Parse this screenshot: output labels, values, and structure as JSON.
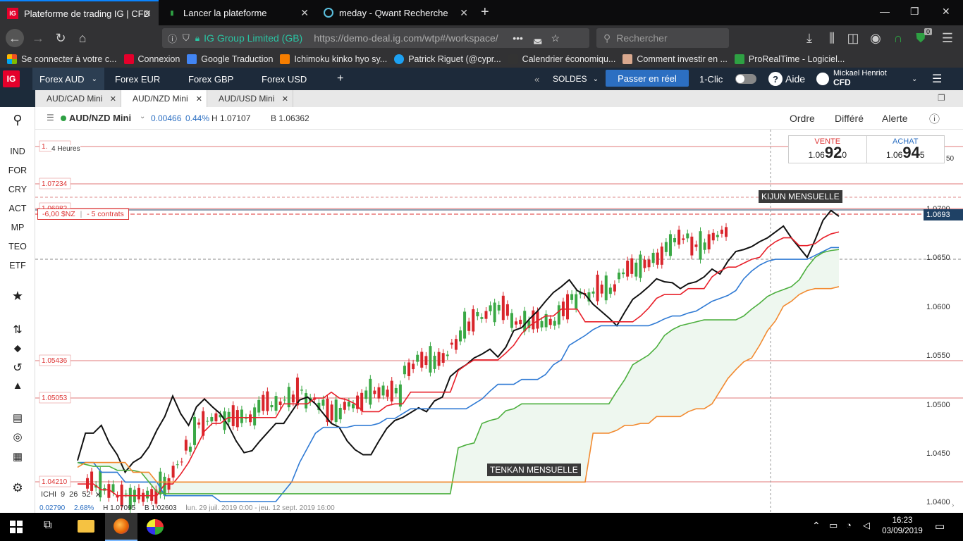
{
  "browser": {
    "tabs": [
      {
        "title": "Plateforme de trading IG | CFD",
        "active": true
      },
      {
        "title": "Lancer la plateforme",
        "active": false
      },
      {
        "title": "meday - Qwant Recherche",
        "active": false
      }
    ],
    "site_identity": "IG Group Limited (GB)",
    "url": "https://demo-deal.ig.com/wtp#/workspace/",
    "search_placeholder": "Rechercher",
    "bookmarks": [
      "Se connecter à votre c...",
      "Connexion",
      "Google Traduction",
      "Ichimoku kinko hyo sy...",
      "Patrick Riguet (@cypr...",
      "Calendrier économiqu...",
      "Comment investir en ...",
      "ProRealTime - Logiciel..."
    ],
    "ext_badge": "0"
  },
  "ig": {
    "logo": "IG",
    "workspaces": [
      "Forex AUD",
      "Forex EUR",
      "Forex GBP",
      "Forex USD"
    ],
    "add_tab": "+",
    "soldes": "SOLDES",
    "go_live": "Passer en réel",
    "one_click": "1-Clic",
    "help": "Aide",
    "user_name": "Mickael Henriot",
    "user_account": "CFD",
    "market_tabs": [
      "AUD/CAD Mini",
      "AUD/NZD Mini",
      "AUD/USD Mini"
    ],
    "left_nav": [
      "IND",
      "FOR",
      "CRY",
      "ACT",
      "MP",
      "TEO",
      "ETF"
    ]
  },
  "panel": {
    "market_name": "AUD/NZD Mini",
    "change": "0.00466",
    "change_pct": "0.44%",
    "high": "H 1.07107",
    "low": "B 1.06362",
    "actions": [
      "Ordre",
      "Différé",
      "Alerte"
    ]
  },
  "ticket": {
    "sell_label": "VENTE",
    "sell_prefix": "1.06",
    "sell_big": "92",
    "sell_small": "0",
    "buy_label": "ACHAT",
    "buy_prefix": "1.06",
    "buy_big": "94",
    "buy_small": "5"
  },
  "chart": {
    "timeframe": "4 Heures",
    "position_pnl": "-6,00 $NZ",
    "position_size": "- 5 contrats",
    "level_labels": [
      "1.07234",
      "1.06982",
      "1.05436",
      "1.05053",
      "1.04210",
      "1."
    ],
    "annotation_kijun": "KIJUN MENSUELLE",
    "annotation_tenkan": "TENKAN MENSUELLE",
    "price_axis": [
      "1.0700",
      "1.0650",
      "1.0600",
      "1.0550",
      "1.0500",
      "1.0450",
      "1.0400"
    ],
    "axis_top_partial": "50",
    "current_price": "1.0693",
    "indicator_name": "ICHI",
    "indicator_params": [
      "9",
      "26",
      "52"
    ],
    "footer_change": "0.02790",
    "footer_pct": "2.68%",
    "footer_high": "H 1.07095",
    "footer_low": "B 1.02603",
    "footer_range": "lun. 29 juil. 2019 0:00 - jeu. 12 sept. 2019 16:00"
  },
  "chart_data": {
    "type": "line",
    "ylim": [
      1.0395,
      1.0755
    ],
    "series": [
      {
        "name": "",
        "color": "#111111",
        "values": [
          1.0442,
          1.047,
          1.047,
          1.0478,
          1.046,
          1.0448,
          1.043,
          1.044,
          1.0445,
          1.0456,
          1.0473,
          1.0487,
          1.0508,
          1.049,
          1.0478,
          1.0497,
          1.0505,
          1.0497,
          1.049,
          1.0478,
          1.0462,
          1.045,
          1.0452,
          1.0462,
          1.0471,
          1.048,
          1.048,
          1.0492,
          1.0504,
          1.0507,
          1.05,
          1.049,
          1.048,
          1.0476,
          1.0462,
          1.0453,
          1.0448,
          1.0448,
          1.0462,
          1.0475,
          1.0483,
          1.0486,
          1.0491,
          1.0496,
          1.0492,
          1.0503,
          1.0507,
          1.0528,
          1.0535,
          1.054,
          1.0547,
          1.0551,
          1.0556,
          1.0548,
          1.0558,
          1.0575,
          1.0578,
          1.0587,
          1.0595,
          1.0605,
          1.0614,
          1.062,
          1.0627,
          1.0616,
          1.0612,
          1.0602,
          1.0595,
          1.0588,
          1.058,
          1.0594,
          1.0607,
          1.0613,
          1.062,
          1.0628,
          1.0625,
          1.0624,
          1.0618,
          1.0623,
          1.0625,
          1.063,
          1.0638,
          1.0633,
          1.0646,
          1.0656,
          1.0658,
          1.0661,
          1.0666,
          1.067,
          1.0676,
          1.0682,
          1.067,
          1.066,
          1.065,
          1.0668,
          1.0688,
          1.0698,
          1.0692
        ]
      },
      {
        "name": "",
        "color": "#e8202a",
        "values": [
          1.0418,
          1.0418,
          1.0418,
          1.0412,
          1.0412,
          1.0406,
          1.0406,
          1.0406,
          1.0406,
          1.0406,
          1.0406,
          1.0418,
          1.0418,
          1.0428,
          1.044,
          1.0456,
          1.0472,
          1.048,
          1.048,
          1.0486,
          1.0486,
          1.0486,
          1.0486,
          1.0486,
          1.0486,
          1.0486,
          1.05,
          1.05,
          1.05,
          1.05,
          1.0506,
          1.0506,
          1.0512,
          1.0506,
          1.0504,
          1.05,
          1.0492,
          1.0492,
          1.0492,
          1.0498,
          1.05,
          1.05,
          1.0512,
          1.0512,
          1.0512,
          1.0512,
          1.0512,
          1.0512,
          1.0534,
          1.054,
          1.0545,
          1.0545,
          1.0545,
          1.0545,
          1.0552,
          1.056,
          1.0572,
          1.058,
          1.0585,
          1.059,
          1.059,
          1.0597,
          1.0597,
          1.0597,
          1.0584,
          1.0584,
          1.0584,
          1.0584,
          1.0584,
          1.0584,
          1.0584,
          1.059,
          1.0598,
          1.0608,
          1.0612,
          1.0612,
          1.0612,
          1.0618,
          1.0618,
          1.0618,
          1.063,
          1.0636,
          1.064,
          1.064,
          1.0644,
          1.0648,
          1.065,
          1.066,
          1.0666,
          1.067,
          1.067,
          1.0662,
          1.0662,
          1.0664,
          1.067,
          1.0674,
          1.0676
        ]
      },
      {
        "name": "",
        "color": "#2f7ad4",
        "values": [
          1.044,
          1.044,
          1.044,
          1.043,
          1.043,
          1.043,
          1.042,
          1.042,
          1.042,
          1.042,
          1.042,
          1.0406,
          1.0406,
          1.0406,
          1.0406,
          1.0406,
          1.0406,
          1.0406,
          1.04,
          1.04,
          1.04,
          1.04,
          1.04,
          1.04,
          1.04,
          1.04,
          1.041,
          1.042,
          1.044,
          1.0455,
          1.047,
          1.0476,
          1.0476,
          1.0476,
          1.0476,
          1.0478,
          1.0478,
          1.0478,
          1.048,
          1.0485,
          1.0485,
          1.049,
          1.0495,
          1.0495,
          1.0495,
          1.0495,
          1.0495,
          1.0495,
          1.0495,
          1.0495,
          1.05,
          1.0505,
          1.0513,
          1.052,
          1.052,
          1.052,
          1.0525,
          1.0525,
          1.0525,
          1.053,
          1.054,
          1.0545,
          1.056,
          1.0565,
          1.057,
          1.0576,
          1.058,
          1.058,
          1.058,
          1.058,
          1.058,
          1.058,
          1.058,
          1.0583,
          1.0587,
          1.059,
          1.059,
          1.0593,
          1.0595,
          1.06,
          1.0605,
          1.0608,
          1.0611,
          1.0616,
          1.0628,
          1.0636,
          1.0642,
          1.0646,
          1.0648,
          1.0648,
          1.0648,
          1.0648,
          1.0648,
          1.0652,
          1.0656,
          1.066,
          1.066
        ]
      },
      {
        "name": "",
        "color": "#4caf3e",
        "values": [
          1.044,
          1.0438,
          1.0436,
          1.0436,
          1.0436,
          1.0432,
          1.0432,
          1.0432,
          1.043,
          1.042,
          1.041,
          1.0408,
          1.0408,
          1.0408,
          1.0408,
          1.0408,
          1.0408,
          1.0408,
          1.0408,
          1.0408,
          1.0408,
          1.0408,
          1.0408,
          1.0408,
          1.0408,
          1.0408,
          1.0408,
          1.0408,
          1.0408,
          1.0408,
          1.0408,
          1.0408,
          1.0408,
          1.0408,
          1.0408,
          1.0408,
          1.0408,
          1.0408,
          1.0408,
          1.0408,
          1.0408,
          1.0408,
          1.0408,
          1.0408,
          1.0408,
          1.0408,
          1.0408,
          1.0408,
          1.0455,
          1.0458,
          1.046,
          1.048,
          1.0483,
          1.0485,
          1.0493,
          1.0495,
          1.05,
          1.05,
          1.05,
          1.05,
          1.05,
          1.05,
          1.05,
          1.05,
          1.05,
          1.05,
          1.05,
          1.05,
          1.0513,
          1.0525,
          1.054,
          1.0545,
          1.055,
          1.0558,
          1.057,
          1.0576,
          1.058,
          1.0582,
          1.0584,
          1.0586,
          1.0586,
          1.0586,
          1.0586,
          1.0586,
          1.059,
          1.0597,
          1.0603,
          1.061,
          1.0614,
          1.0617,
          1.062,
          1.0627,
          1.064,
          1.065,
          1.0655,
          1.0657,
          1.0658
        ]
      },
      {
        "name": "",
        "color": "#f28a30",
        "values": [
          1.0435,
          1.044,
          1.044,
          1.044,
          1.044,
          1.044,
          1.044,
          1.043,
          1.043,
          1.043,
          1.042,
          1.042,
          1.042,
          1.042,
          1.042,
          1.042,
          1.042,
          1.042,
          1.042,
          1.042,
          1.042,
          1.042,
          1.042,
          1.042,
          1.042,
          1.042,
          1.042,
          1.042,
          1.042,
          1.042,
          1.042,
          1.042,
          1.042,
          1.042,
          1.042,
          1.042,
          1.042,
          1.042,
          1.042,
          1.042,
          1.042,
          1.042,
          1.042,
          1.042,
          1.042,
          1.042,
          1.042,
          1.042,
          1.042,
          1.042,
          1.042,
          1.042,
          1.042,
          1.042,
          1.042,
          1.042,
          1.042,
          1.042,
          1.042,
          1.042,
          1.042,
          1.042,
          1.042,
          1.042,
          1.042,
          1.047,
          1.047,
          1.047,
          1.0473,
          1.0478,
          1.0478,
          1.048,
          1.048,
          1.0487,
          1.0487,
          1.0487,
          1.0487,
          1.0492,
          1.0495,
          1.0495,
          1.05,
          1.0513,
          1.0526,
          1.0535,
          1.0543,
          1.0547,
          1.056,
          1.0575,
          1.0585,
          1.06,
          1.0605,
          1.0612,
          1.0616,
          1.0618,
          1.0618,
          1.0618,
          1.062
        ]
      }
    ]
  },
  "taskbar": {
    "time": "16:23",
    "date": "03/09/2019"
  }
}
